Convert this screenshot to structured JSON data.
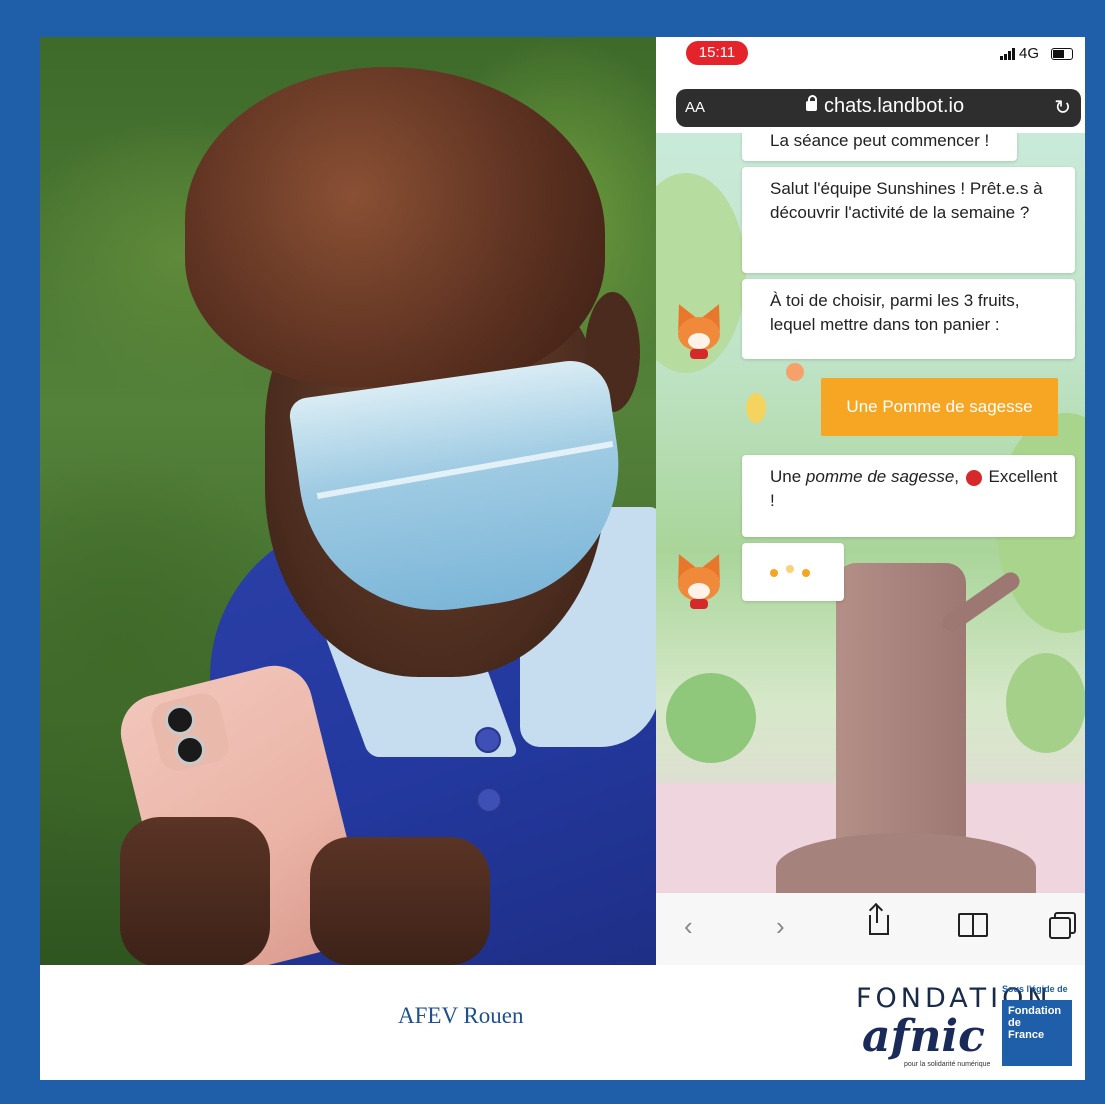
{
  "caption": "AFEV Rouen",
  "phone": {
    "status": {
      "time": "15:11",
      "network": "4G"
    },
    "browser": {
      "text_size_label": "AA",
      "url": "chats.landbot.io"
    },
    "chat": {
      "cut_off_message": "La séance peut commencer !",
      "messages": [
        "Salut l'équipe Sunshines ! Prêt.e.s à découvrir l'activité de la semaine ?",
        "À toi de choisir, parmi les 3 fruits, lequel mettre dans ton panier :"
      ],
      "user_choice": "Une Pomme de sagesse",
      "reply": {
        "prefix": "Une ",
        "italic": "pomme de sagesse",
        "suffix": ", ",
        "after_emoji": "Excellent !"
      }
    }
  },
  "logos": {
    "fondation": "FONDATION",
    "afnic": "afnic",
    "afnic_tagline": "pour la solidarité numérique",
    "egide": "Sous l'égide de",
    "fdf_line1": "Fondation",
    "fdf_line2": "de",
    "fdf_line3": "France"
  },
  "colors": {
    "frame": "#1f5ea8",
    "orange": "#f6a623",
    "status_red": "#e5232a"
  }
}
